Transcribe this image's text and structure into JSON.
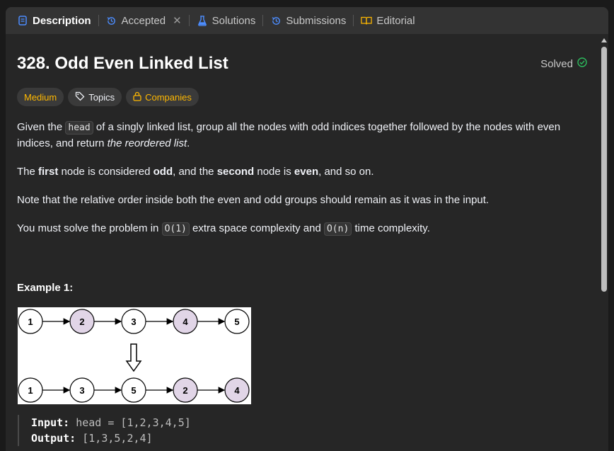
{
  "tabs": [
    {
      "label": "Description"
    },
    {
      "label": "Accepted"
    },
    {
      "label": "Solutions"
    },
    {
      "label": "Submissions"
    },
    {
      "label": "Editorial"
    }
  ],
  "problem": {
    "title": "328. Odd Even Linked List",
    "status": "Solved",
    "difficulty": "Medium",
    "topics_label": "Topics",
    "companies_label": "Companies"
  },
  "description": {
    "p1_a": "Given the ",
    "p1_code": "head",
    "p1_b": " of a singly linked list, group all the nodes with odd indices together followed by the nodes with even indices, and return ",
    "p1_em": "the reordered list",
    "p1_c": ".",
    "p2_a": "The ",
    "p2_b1": "first",
    "p2_b": " node is considered ",
    "p2_b2": "odd",
    "p2_c": ", and the ",
    "p2_b3": "second",
    "p2_d": " node is ",
    "p2_b4": "even",
    "p2_e": ", and so on.",
    "p3": "Note that the relative order inside both the even and odd groups should remain as it was in the input.",
    "p4_a": "You must solve the problem in ",
    "p4_code1": "O(1)",
    "p4_b": " extra space complexity and ",
    "p4_code2": "O(n)",
    "p4_c": " time complexity."
  },
  "example": {
    "title": "Example 1:",
    "top_row": [
      "1",
      "2",
      "3",
      "4",
      "5"
    ],
    "bottom_row": [
      "1",
      "3",
      "5",
      "2",
      "4"
    ],
    "input_label": "Input:",
    "input_value": "head = [1,2,3,4,5]",
    "output_label": "Output:",
    "output_value": "[1,3,5,2,4]"
  },
  "colors": {
    "odd_node": "#ffffff",
    "even_node": "#e1d5e7",
    "difficulty": "#ffb800",
    "solved_check": "#2cbb5d"
  }
}
